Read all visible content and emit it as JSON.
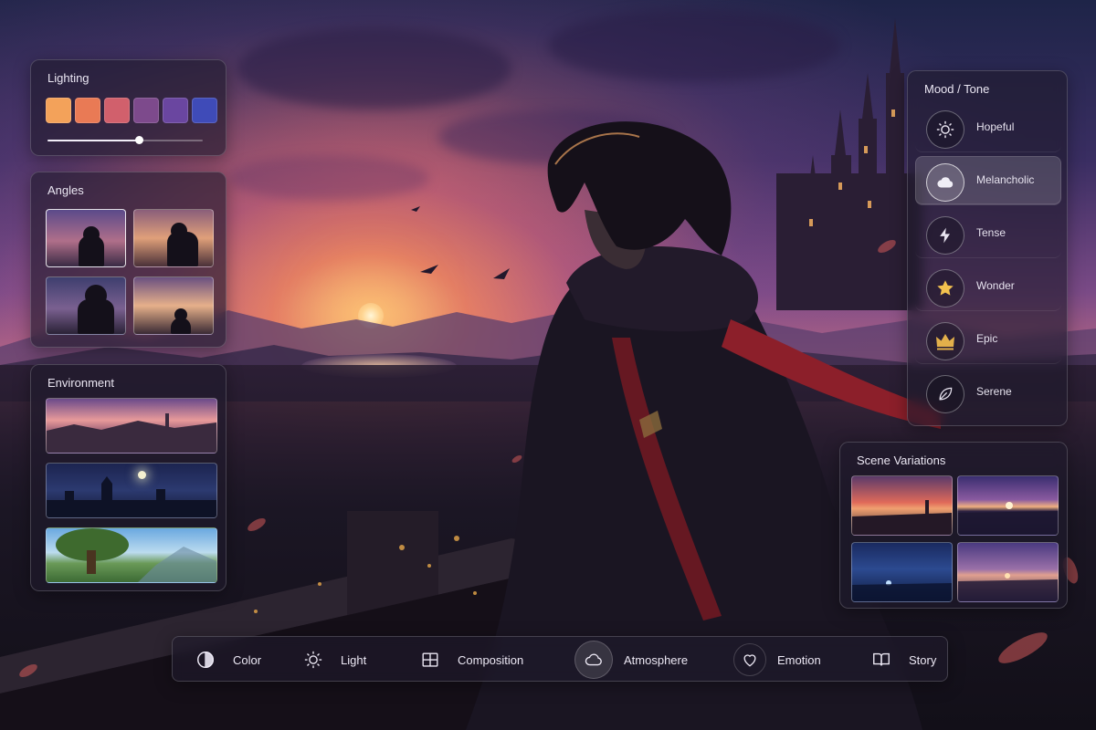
{
  "lighting": {
    "title": "Lighting",
    "swatches": [
      "#f3a25a",
      "#e97a55",
      "#d1606c",
      "#7d4a8c",
      "#6a46a0",
      "#3f4bb8"
    ],
    "slider_value": 0.59
  },
  "angles": {
    "title": "Angles",
    "selected_index": 0
  },
  "environment": {
    "title": "Environment"
  },
  "mood": {
    "title": "Mood / Tone",
    "items": [
      {
        "label": "Hopeful",
        "icon": "sun-icon"
      },
      {
        "label": "Melancholic",
        "icon": "cloud-icon"
      },
      {
        "label": "Tense",
        "icon": "lightning-icon"
      },
      {
        "label": "Wonder",
        "icon": "star-icon"
      },
      {
        "label": "Epic",
        "icon": "crown-icon"
      },
      {
        "label": "Serene",
        "icon": "leaf-icon"
      }
    ],
    "selected": "Melancholic"
  },
  "variations": {
    "title": "Scene Variations"
  },
  "toolbar": {
    "items": [
      {
        "label": "Color",
        "icon": "color-wheel-icon"
      },
      {
        "label": "Light",
        "icon": "sun-icon"
      },
      {
        "label": "Composition",
        "icon": "grid-icon"
      },
      {
        "label": "Atmosphere",
        "icon": "cloud-icon"
      },
      {
        "label": "Emotion",
        "icon": "heart-icon"
      },
      {
        "label": "Story",
        "icon": "book-icon"
      }
    ],
    "selected": "Atmosphere"
  },
  "colors": {
    "accent_star": "#f2c14e",
    "accent_crown": "#e3b04b"
  }
}
